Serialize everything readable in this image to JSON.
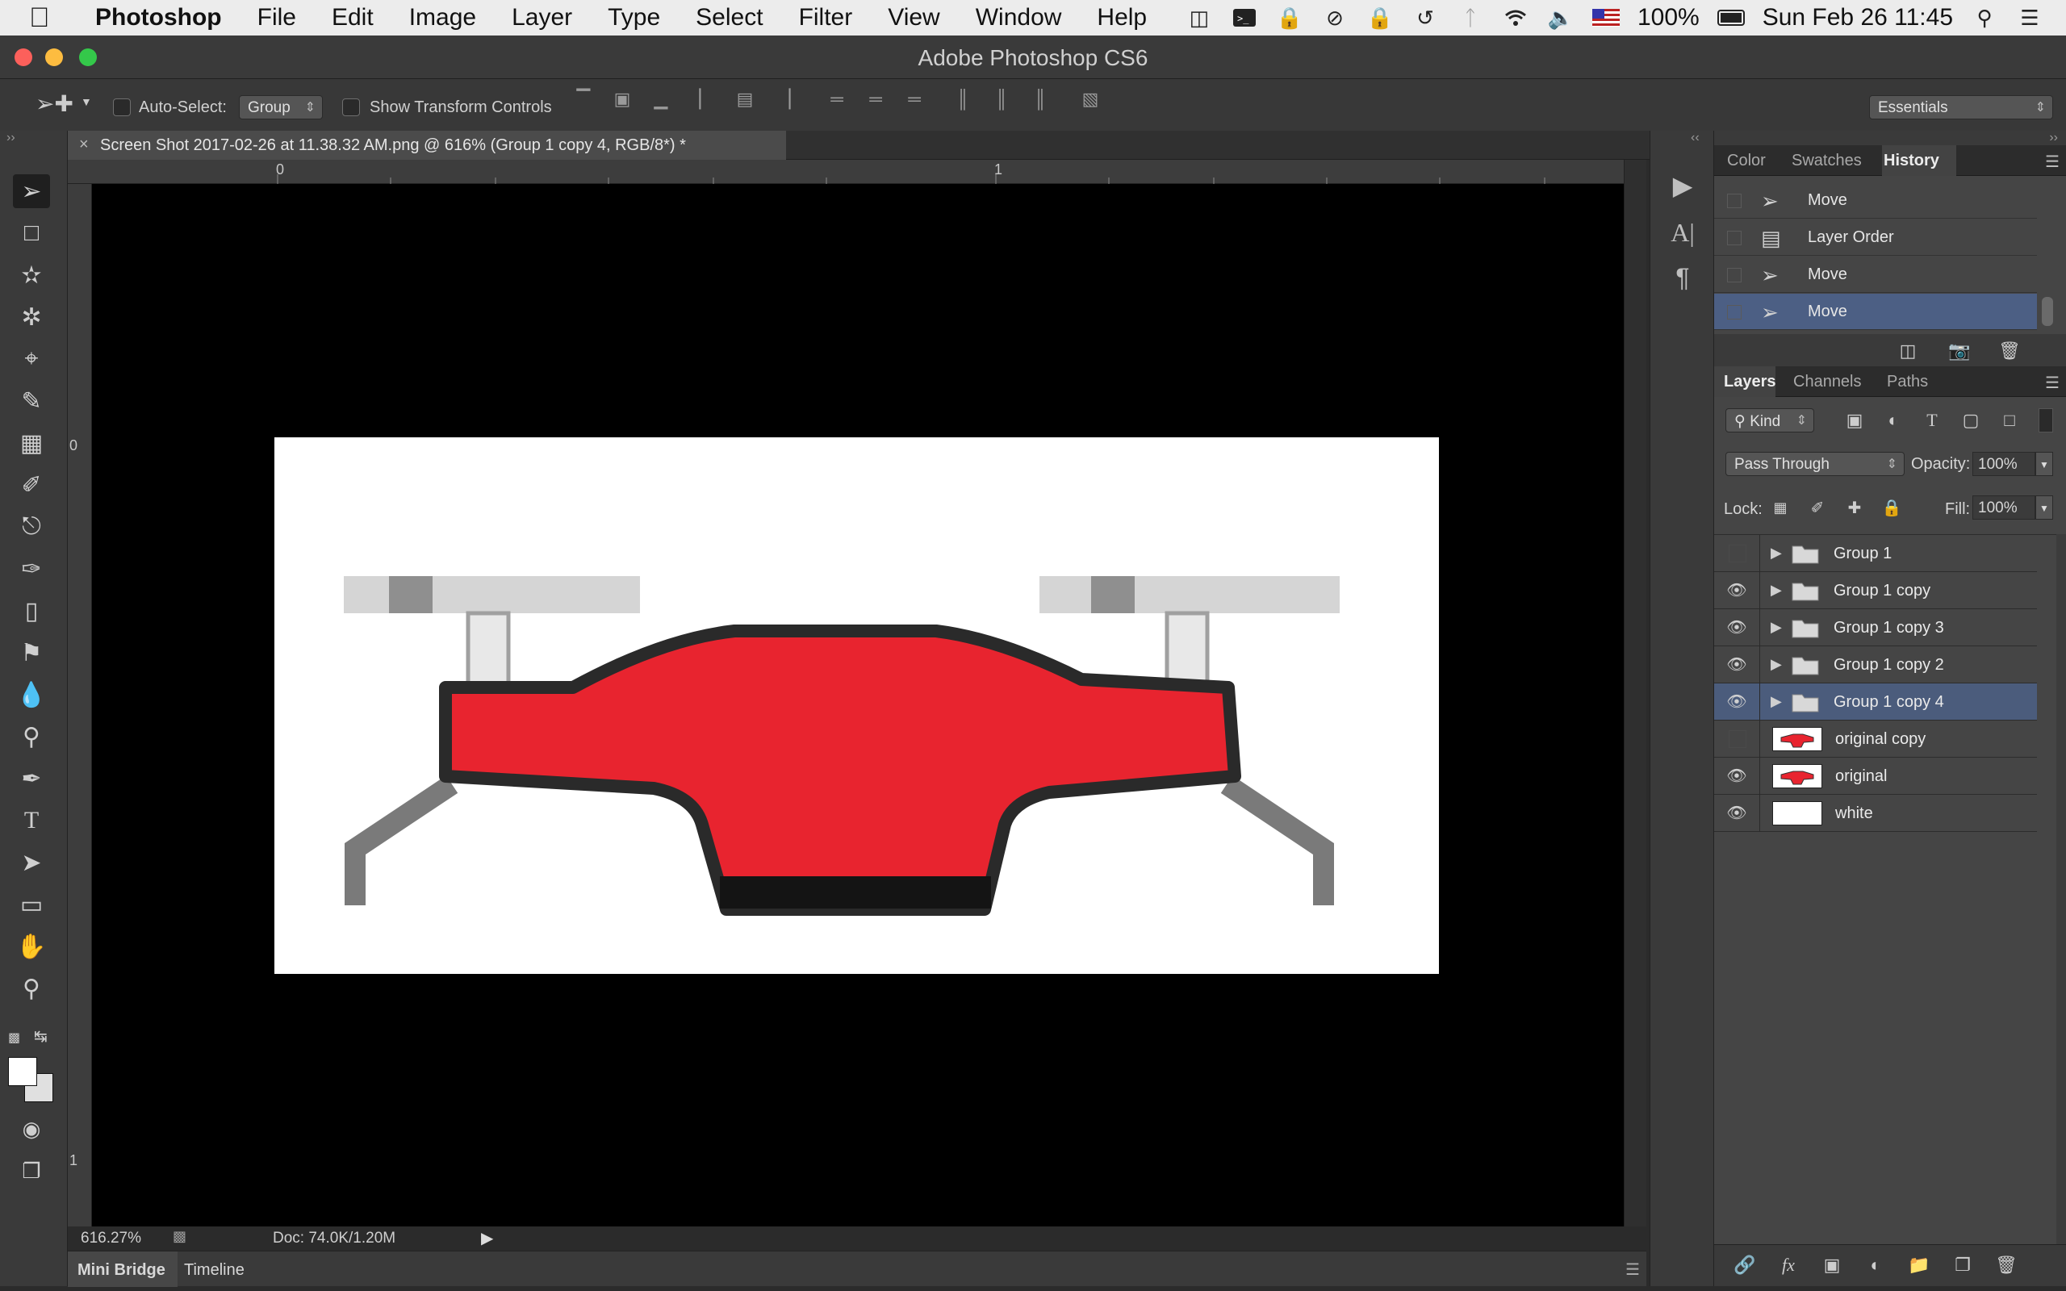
{
  "menubar": {
    "app": "Photoshop",
    "items": [
      "File",
      "Edit",
      "Image",
      "Layer",
      "Type",
      "Select",
      "Filter",
      "View",
      "Window",
      "Help"
    ],
    "battery": "100%",
    "clock": "Sun Feb 26  11:45",
    "status_icons": [
      "airplay-icon",
      "terminal-icon",
      "lock-icon",
      "sync-icon",
      "lock-icon",
      "time-machine-icon",
      "bluetooth-icon",
      "wifi-icon",
      "volume-icon",
      "flag-icon",
      "battery-icon",
      "spotlight-icon",
      "notification-list-icon"
    ]
  },
  "window": {
    "title": "Adobe Photoshop CS6",
    "traffic_colors": [
      "#fc605b",
      "#fdbc40",
      "#34c84a"
    ]
  },
  "options": {
    "auto_select_label": "Auto-Select:",
    "auto_select_value": "Group",
    "show_transform_label": "Show Transform Controls",
    "workspace": "Essentials"
  },
  "document": {
    "tab_title": "Screen Shot 2017-02-26 at 11.38.32 AM.png @ 616% (Group 1 copy 4, RGB/8*) *",
    "ruler_h": [
      "0",
      "1"
    ],
    "ruler_v": [
      "0",
      "1"
    ],
    "zoom": "616.27%",
    "doc_info": "Doc: 74.0K/1.20M"
  },
  "bottom_tabs": [
    "Mini Bridge",
    "Timeline"
  ],
  "history": {
    "tabs": [
      "Color",
      "Swatches",
      "History"
    ],
    "active_tab": "History",
    "items": [
      {
        "label": "Move",
        "icon": "move-tool-icon",
        "selected": false
      },
      {
        "label": "Layer Order",
        "icon": "layer-order-icon",
        "selected": false
      },
      {
        "label": "Move",
        "icon": "move-tool-icon",
        "selected": false
      },
      {
        "label": "Move",
        "icon": "move-tool-icon",
        "selected": true
      }
    ]
  },
  "layers": {
    "tabs": [
      "Layers",
      "Channels",
      "Paths"
    ],
    "active_tab": "Layers",
    "filter_kind": "Kind",
    "blend_mode": "Pass Through",
    "opacity_label": "Opacity:",
    "opacity": "100%",
    "lock_label": "Lock:",
    "fill_label": "Fill:",
    "fill": "100%",
    "items": [
      {
        "name": "Group 1",
        "type": "group",
        "visible": false,
        "selected": false
      },
      {
        "name": "Group 1 copy",
        "type": "group",
        "visible": true,
        "selected": false
      },
      {
        "name": "Group 1 copy 3",
        "type": "group",
        "visible": true,
        "selected": false
      },
      {
        "name": "Group 1 copy 2",
        "type": "group",
        "visible": true,
        "selected": false
      },
      {
        "name": "Group 1 copy 4",
        "type": "group",
        "visible": true,
        "selected": true
      },
      {
        "name": "original copy",
        "type": "image",
        "visible": false,
        "selected": false
      },
      {
        "name": "original",
        "type": "image",
        "visible": true,
        "selected": false
      },
      {
        "name": "white",
        "type": "fill",
        "visible": true,
        "selected": false
      }
    ]
  },
  "colors": {
    "drone_red": "#e8242f",
    "selection": "#4b5c7c"
  }
}
